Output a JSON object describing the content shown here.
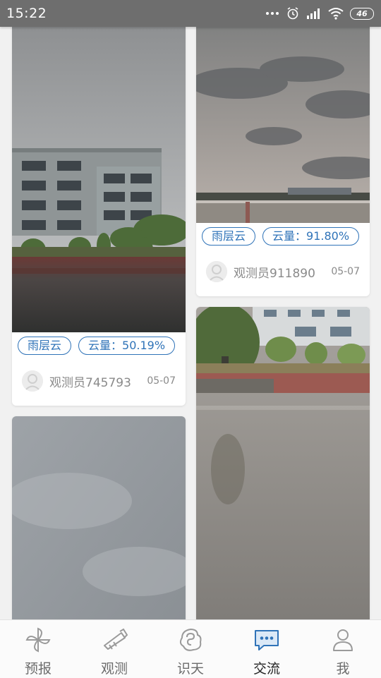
{
  "status_bar": {
    "time": "15:22",
    "battery": "46"
  },
  "feed": {
    "posts": [
      {
        "cloud_type": "雨层云",
        "cloud_amount": "云量：50.19%",
        "observer": "观测员745793",
        "date": "05-07",
        "photo": "grey-building-rainy-plaza"
      },
      {
        "cloud_type": "雨层云",
        "cloud_amount": "云量：91.80%",
        "observer": "观测员911890",
        "date": "05-07",
        "photo": "overcast-sky-over-rooftop"
      },
      {
        "photo": "grey-overcast-sky"
      },
      {
        "photo": "wet-courtyard-with-trees"
      }
    ]
  },
  "bottom_nav": {
    "active": "交流",
    "items": [
      {
        "label": "预报",
        "icon": "pinwheel-icon"
      },
      {
        "label": "观测",
        "icon": "telescope-icon"
      },
      {
        "label": "识天",
        "icon": "cloud-swirl-icon"
      },
      {
        "label": "交流",
        "icon": "chat-bubble-icon"
      },
      {
        "label": "我",
        "icon": "person-icon"
      }
    ]
  },
  "colors": {
    "status_bar": "#6e6e6e",
    "tag_border": "#2f73b8",
    "active_icon": "#2f73b8",
    "inactive_icon": "#9a9a9a"
  }
}
